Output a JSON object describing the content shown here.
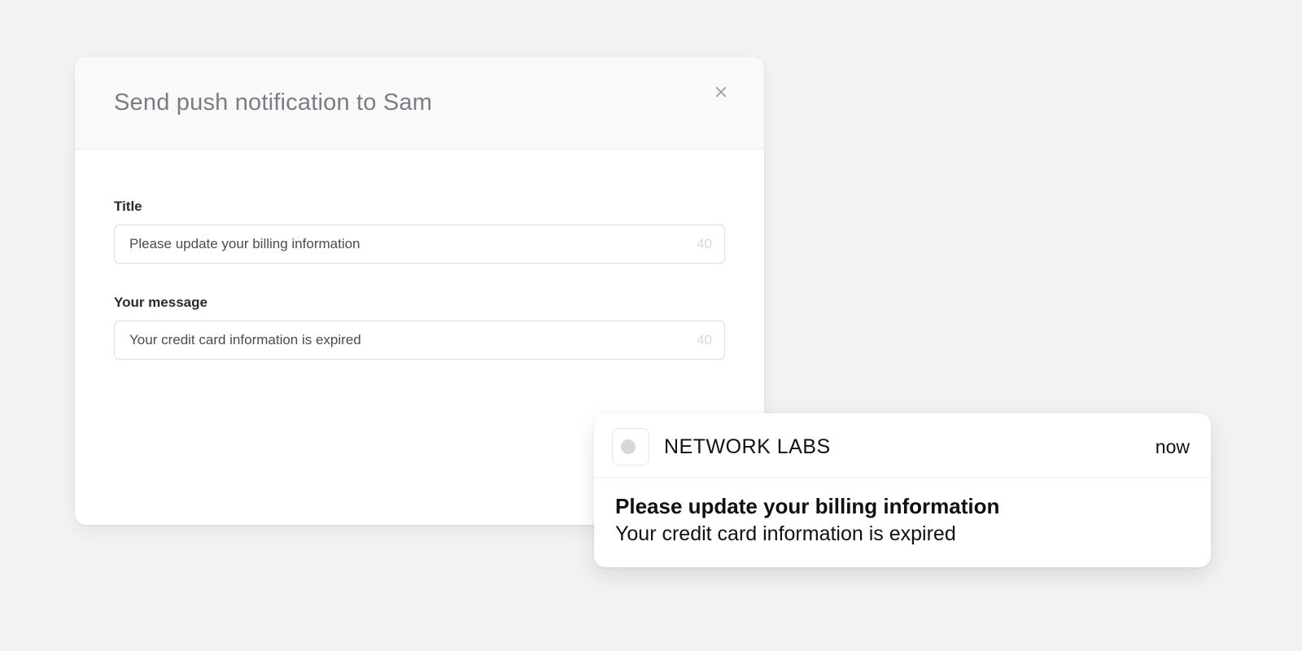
{
  "modal": {
    "title": "Send push notification to Sam",
    "title_field": {
      "label": "Title",
      "value": "Please update your billing information",
      "remaining": "40"
    },
    "message_field": {
      "label": "Your message",
      "value": "Your credit card information is expired",
      "remaining": "40"
    }
  },
  "notification": {
    "app_name": "NETWORK LABS",
    "time": "now",
    "title": "Please update your billing information",
    "message": "Your credit card information is expired"
  }
}
